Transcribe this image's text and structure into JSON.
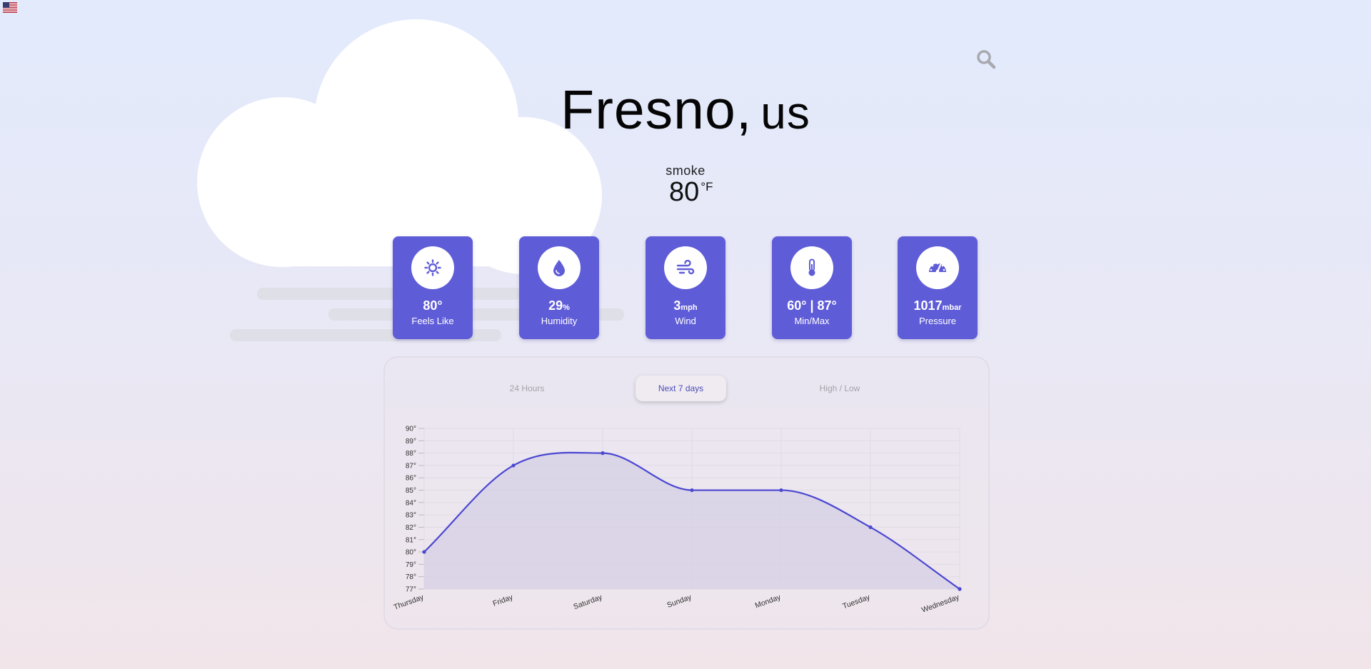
{
  "location": {
    "city": "Fresno,",
    "country": "us"
  },
  "current": {
    "condition": "smoke",
    "temperature": "80",
    "unit": "°F"
  },
  "stats": [
    {
      "icon": "sun-icon",
      "value": "80°",
      "unit": "",
      "label": "Feels Like"
    },
    {
      "icon": "droplet-icon",
      "value": "29",
      "unit": "%",
      "label": "Humidity"
    },
    {
      "icon": "wind-icon",
      "value": "3",
      "unit": "mph",
      "label": "Wind"
    },
    {
      "icon": "thermometer-icon",
      "value": "60° | 87°",
      "unit": "",
      "label": "Min/Max"
    },
    {
      "icon": "gauge-icon",
      "value": "1017",
      "unit": "mbar",
      "label": "Pressure"
    }
  ],
  "tabs": [
    {
      "label": "24 Hours",
      "active": false
    },
    {
      "label": "Next 7 days",
      "active": true
    },
    {
      "label": "High / Low",
      "active": false
    }
  ],
  "colors": {
    "accent": "#5f5cd8",
    "line": "#4a47d1",
    "fill": "#d6cfe6"
  },
  "chart_data": {
    "type": "area",
    "categories": [
      "Thursday",
      "Friday",
      "Saturday",
      "Sunday",
      "Monday",
      "Tuesday",
      "Wednesday"
    ],
    "series": [
      {
        "values": [
          80,
          87,
          88,
          85,
          85,
          82,
          77
        ]
      }
    ],
    "ylim": [
      77,
      90
    ],
    "yticks": [
      "77°",
      "78°",
      "79°",
      "80°",
      "81°",
      "82°",
      "83°",
      "84°",
      "85°",
      "86°",
      "87°",
      "88°",
      "89°",
      "90°"
    ],
    "grid": true
  }
}
